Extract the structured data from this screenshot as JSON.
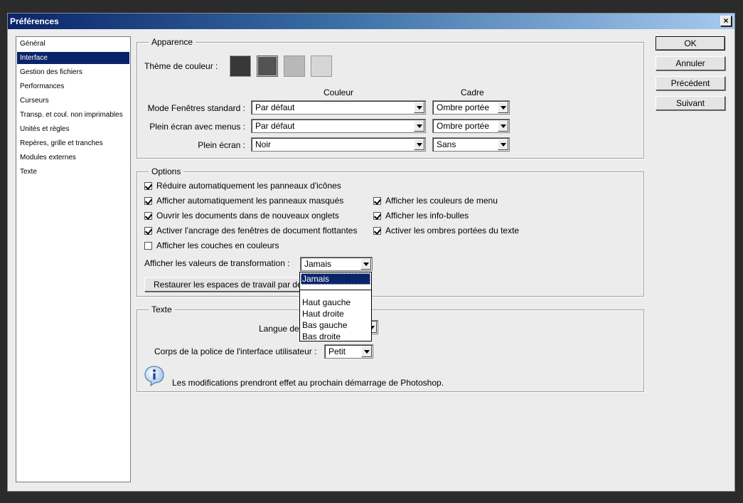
{
  "window": {
    "title": "Préférences",
    "close_glyph": "×"
  },
  "sidebar": {
    "items": [
      {
        "label": "Général"
      },
      {
        "label": "Interface"
      },
      {
        "label": "Gestion des fichiers"
      },
      {
        "label": "Performances"
      },
      {
        "label": "Curseurs"
      },
      {
        "label": "Transp. et coul. non imprimables"
      },
      {
        "label": "Unités et règles"
      },
      {
        "label": "Repères, grille et tranches"
      },
      {
        "label": "Modules externes"
      },
      {
        "label": "Texte"
      }
    ],
    "selected_index": 1
  },
  "apparence": {
    "legend": "Apparence",
    "theme_label": "Thème de couleur :",
    "themes": [
      {
        "color": "#383838"
      },
      {
        "color": "#535353"
      },
      {
        "color": "#b8b8b8"
      },
      {
        "color": "#d6d6d6"
      }
    ],
    "selected_theme": 1,
    "col_couleur": "Couleur",
    "col_cadre": "Cadre",
    "rows": [
      {
        "label": "Mode Fenêtres standard :",
        "couleur": "Par défaut",
        "cadre": "Ombre portée"
      },
      {
        "label": "Plein écran avec menus :",
        "couleur": "Par défaut",
        "cadre": "Ombre portée"
      },
      {
        "label": "Plein écran :",
        "couleur": "Noir",
        "cadre": "Sans"
      }
    ]
  },
  "options": {
    "legend": "Options",
    "left": [
      {
        "label": "Réduire automatiquement les panneaux d'icônes",
        "checked": true
      },
      {
        "label": "Afficher automatiquement les panneaux masqués",
        "checked": true
      },
      {
        "label": "Ouvrir les documents dans de nouveaux onglets",
        "checked": true
      },
      {
        "label": "Activer l'ancrage des fenêtres de document flottantes",
        "checked": true
      },
      {
        "label": "Afficher les couches en couleurs",
        "checked": false
      }
    ],
    "right": [
      {
        "label": "Afficher les couleurs de menu",
        "checked": true
      },
      {
        "label": "Afficher les info-bulles",
        "checked": true
      },
      {
        "label": "Activer les ombres portées du texte",
        "checked": true
      }
    ],
    "transform_label": "Afficher les valeurs de transformation :",
    "transform_value": "Jamais",
    "restore_button": "Restaurer les espaces de travail par dé"
  },
  "transform_dropdown": {
    "options": [
      "Jamais",
      "Haut gauche",
      "Haut droite",
      "Bas gauche",
      "Bas droite"
    ],
    "selected": "Jamais"
  },
  "texte": {
    "legend": "Texte",
    "langue_label": "Langue de",
    "corps_label": "Corps de la police de l'interface utilisateur :",
    "corps_value": "Petit",
    "info_text": "Les modifications prendront effet au prochain démarrage de Photoshop.",
    "info_icon": "info-icon"
  },
  "buttons": {
    "ok": "OK",
    "annuler": "Annuler",
    "precedent": "Précédent",
    "suivant": "Suivant"
  }
}
